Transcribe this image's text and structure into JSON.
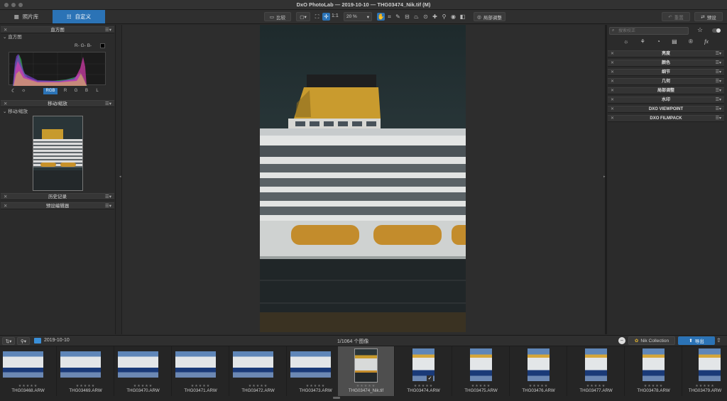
{
  "window": {
    "title": "DxO PhotoLab — 2019-10-10 — THG03474_Nik.tif (M)"
  },
  "toolbar": {
    "tab_library": "照片库",
    "tab_customize": "自定义",
    "compare_label": "比较",
    "one_to_one": "1:1",
    "zoom": "20 %",
    "local_adjust_label": "局部调整",
    "reset_label": "重置",
    "preset_label": "预设"
  },
  "left": {
    "histogram_title": "直方图",
    "histogram_sub": "直方图",
    "rgb_readout": "R-  G-  B-",
    "channels": [
      "RGB",
      "R",
      "G",
      "B",
      "L"
    ],
    "move_zoom_title": "移动/缩放",
    "move_zoom_sub": "移动/缩放",
    "history_title": "历史记录",
    "preset_editor_title": "预设编辑器"
  },
  "right": {
    "search_placeholder": "搜索校正",
    "sections": [
      "亮度",
      "颜色",
      "细节",
      "几何",
      "局部调整",
      "水印",
      "DXO VIEWPOINT",
      "DXO FILMPACK"
    ]
  },
  "filmbar": {
    "folder": "2019-10-10",
    "count": "1/1064 个图像",
    "nik_label": "Nik Collection",
    "export_label": "导出"
  },
  "thumbnails": [
    {
      "name": "THG03468.ARW",
      "stars": "★★★★★"
    },
    {
      "name": "THG03469.ARW",
      "stars": "★★★★★"
    },
    {
      "name": "THG03470.ARW",
      "stars": "★★★★★"
    },
    {
      "name": "THG03471.ARW",
      "stars": "★★★★★"
    },
    {
      "name": "THG03472.ARW",
      "stars": "★★★★★"
    },
    {
      "name": "THG03473.ARW",
      "stars": "★★★★★"
    },
    {
      "name": "THG03474_Nik.tif",
      "stars": "★★★★★"
    },
    {
      "name": "THG03474.ARW",
      "stars": "★★★★★"
    },
    {
      "name": "THG03475.ARW",
      "stars": "★★★★★"
    },
    {
      "name": "THG03476.ARW",
      "stars": "★★★★★"
    },
    {
      "name": "THG03477.ARW",
      "stars": "★★★★★"
    },
    {
      "name": "THG03478.ARW",
      "stars": "★★★★★"
    },
    {
      "name": "THG03479.ARW",
      "stars": "★★★★★"
    }
  ],
  "colors": {
    "accent": "#2b73b6",
    "funnel": "#d9a32a",
    "sky": "#2a3b3f",
    "hull": "#1f2426"
  }
}
